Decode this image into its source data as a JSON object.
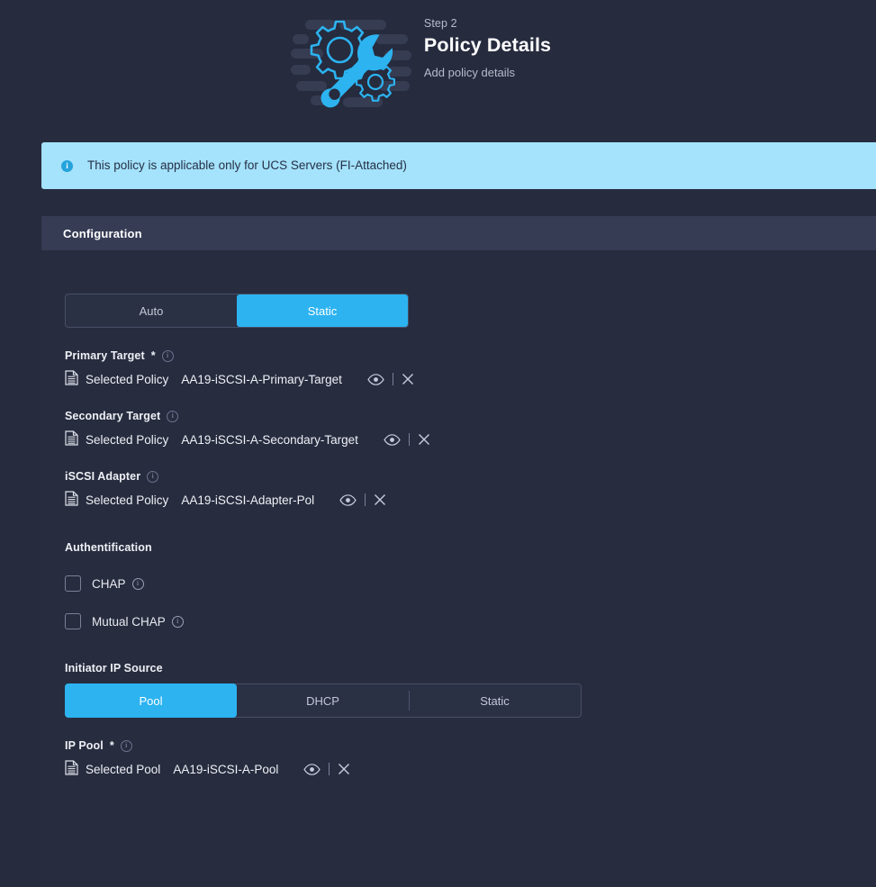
{
  "header": {
    "step_label": "Step 2",
    "title": "Policy Details",
    "subtitle": "Add policy details",
    "illustration_icon": "gear-wrench-illustration"
  },
  "banner": {
    "icon": "info-icon",
    "text": "This policy is applicable only for UCS Servers (FI-Attached)",
    "background": "#a5e2fb",
    "text_color": "#243047"
  },
  "section": {
    "title": "Configuration"
  },
  "mode_toggle": {
    "options": [
      {
        "label": "Auto",
        "selected": false
      },
      {
        "label": "Static",
        "selected": true
      }
    ],
    "selected": "Static",
    "accent": "#2cb3f0"
  },
  "fields": [
    {
      "label": "Primary Target",
      "required": true,
      "required_mark": "*",
      "info_icon": "info-icon",
      "selector_kind": "Selected Policy",
      "value": "AA19-iSCSI-A-Primary-Target",
      "doc_icon": "policy-document-icon",
      "view_icon": "eye-icon",
      "clear_icon": "close-icon"
    },
    {
      "label": "Secondary Target",
      "required": false,
      "required_mark": "",
      "info_icon": "info-icon",
      "selector_kind": "Selected Policy",
      "value": "AA19-iSCSI-A-Secondary-Target",
      "doc_icon": "policy-document-icon",
      "view_icon": "eye-icon",
      "clear_icon": "close-icon"
    },
    {
      "label": "iSCSI Adapter",
      "required": false,
      "required_mark": "",
      "info_icon": "info-icon",
      "selector_kind": "Selected Policy",
      "value": "AA19-iSCSI-Adapter-Pol",
      "doc_icon": "policy-document-icon",
      "view_icon": "eye-icon",
      "clear_icon": "close-icon"
    }
  ],
  "authentication": {
    "title": "Authentification",
    "checkboxes": [
      {
        "label": "CHAP",
        "checked": false,
        "info_icon": "info-icon"
      },
      {
        "label": "Mutual CHAP",
        "checked": false,
        "info_icon": "info-icon"
      }
    ]
  },
  "initiator_ip_source": {
    "title": "Initiator IP Source",
    "options": [
      {
        "label": "Pool",
        "selected": true
      },
      {
        "label": "DHCP",
        "selected": false
      },
      {
        "label": "Static",
        "selected": false
      }
    ],
    "selected": "Pool"
  },
  "ip_pool": {
    "label": "IP Pool",
    "required": true,
    "required_mark": "*",
    "info_icon": "info-icon",
    "selector_kind": "Selected Pool",
    "value": "AA19-iSCSI-A-Pool",
    "doc_icon": "policy-document-icon",
    "view_icon": "eye-icon",
    "clear_icon": "close-icon"
  },
  "colors": {
    "page_background": "#262b3e",
    "panel_background": "#272c3f",
    "section_bar": "#363c54",
    "accent_blue": "#2cb3f0",
    "muted_text": "#b6bcca"
  }
}
